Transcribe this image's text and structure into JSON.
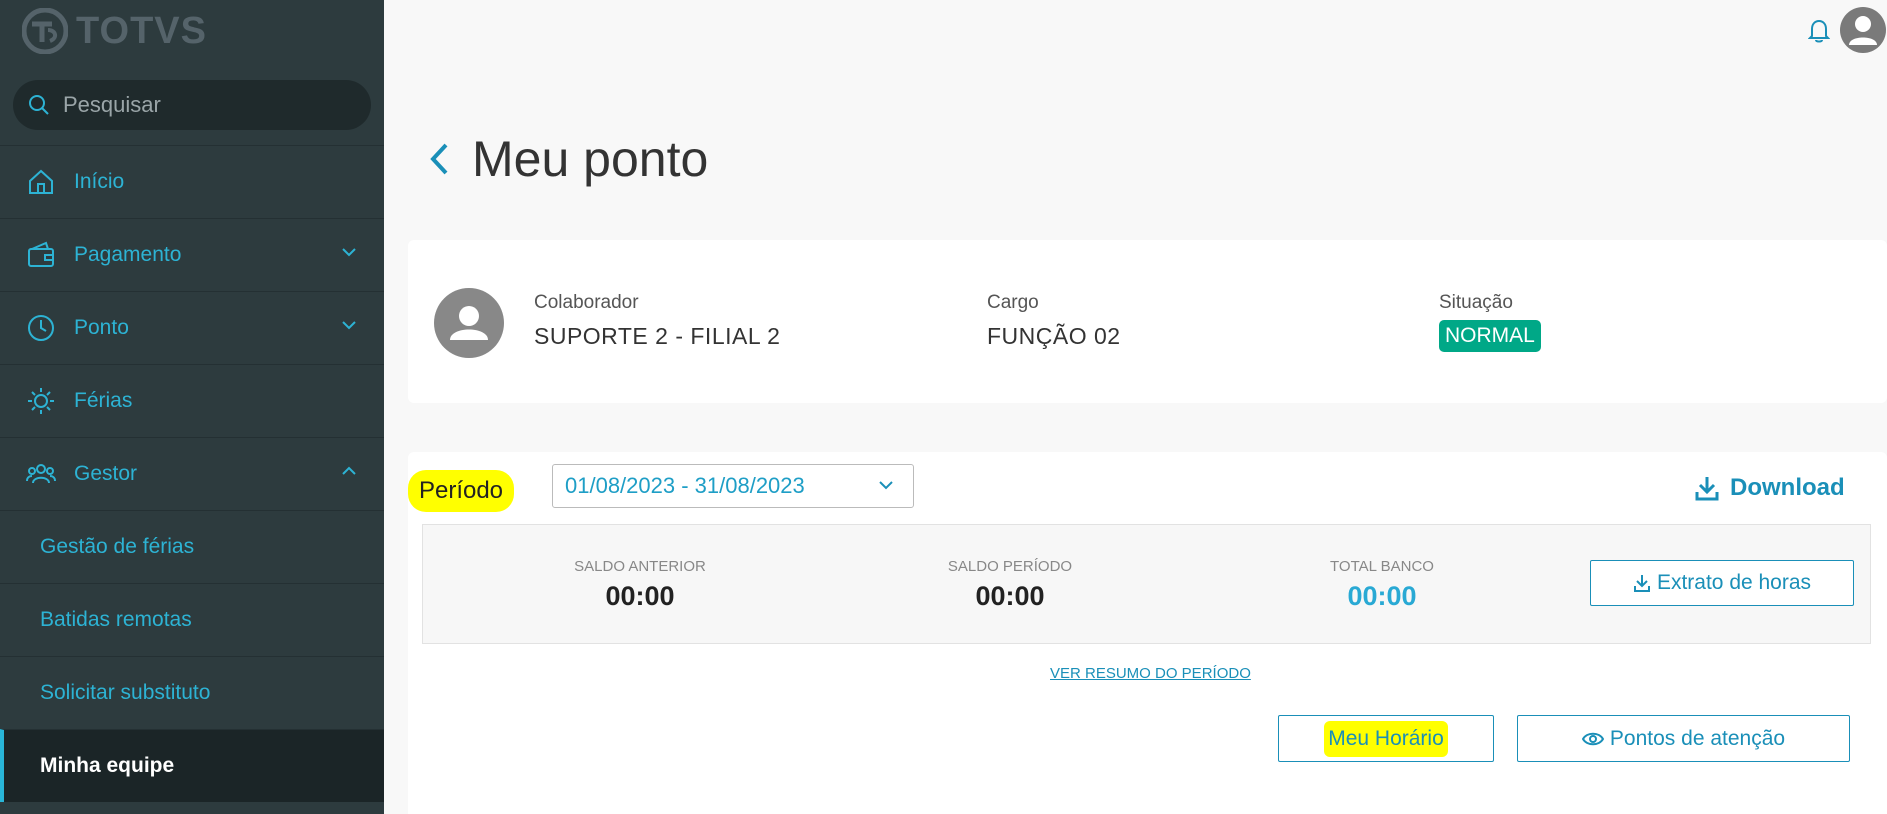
{
  "sidebar": {
    "logo_text": "TOTVS",
    "search_placeholder": "Pesquisar",
    "items": [
      {
        "label": "Início",
        "icon": "home-icon"
      },
      {
        "label": "Pagamento",
        "icon": "wallet-icon",
        "expanded": false
      },
      {
        "label": "Ponto",
        "icon": "clock-icon",
        "expanded": false
      },
      {
        "label": "Férias",
        "icon": "sun-icon"
      },
      {
        "label": "Gestor",
        "icon": "users-icon",
        "expanded": true
      }
    ],
    "subitems": [
      {
        "label": "Gestão de férias"
      },
      {
        "label": "Batidas remotas"
      },
      {
        "label": "Solicitar substituto"
      },
      {
        "label": "Minha equipe",
        "active": true
      }
    ]
  },
  "header": {
    "bell_icon": "bell-icon",
    "avatar_icon": "user-avatar-icon"
  },
  "page": {
    "title": "Meu ponto"
  },
  "employee": {
    "colaborador_label": "Colaborador",
    "colaborador_value": "SUPORTE 2 - FILIAL 2",
    "cargo_label": "Cargo",
    "cargo_value": "FUNÇÃO 02",
    "situacao_label": "Situação",
    "situacao_value": "NORMAL"
  },
  "period": {
    "label": "Período",
    "selected": "01/08/2023 - 31/08/2023",
    "download_label": "Download"
  },
  "balances": {
    "saldo_anterior_label": "SALDO ANTERIOR",
    "saldo_anterior_value": "00:00",
    "saldo_periodo_label": "SALDO PERÍODO",
    "saldo_periodo_value": "00:00",
    "total_banco_label": "TOTAL BANCO",
    "total_banco_value": "00:00",
    "extrato_label": "Extrato de horas"
  },
  "links": {
    "resumo_label": "VER RESUMO DO PERÍODO"
  },
  "actions": {
    "meu_horario_label": "Meu Horário",
    "pontos_atencao_label": "Pontos de atenção"
  },
  "colors": {
    "sidebar_bg": "#2d3b3e",
    "accent": "#1a8fb8",
    "status_green": "#00a887",
    "highlight": "#ffff00"
  }
}
